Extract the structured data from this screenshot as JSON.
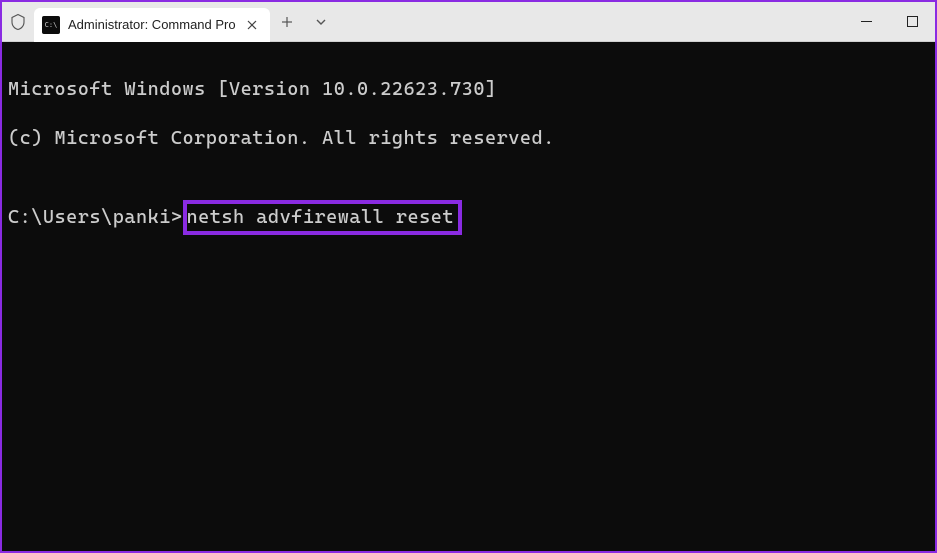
{
  "titlebar": {
    "tab_title": "Administrator: Command Pro",
    "tab_icon_label": "cmd"
  },
  "terminal": {
    "line1": "Microsoft Windows [Version 10.0.22623.730]",
    "line2": "(c) Microsoft Corporation. All rights reserved.",
    "blank": "",
    "prompt": "C:\\Users\\panki>",
    "command": "netsh advfirewall reset"
  }
}
